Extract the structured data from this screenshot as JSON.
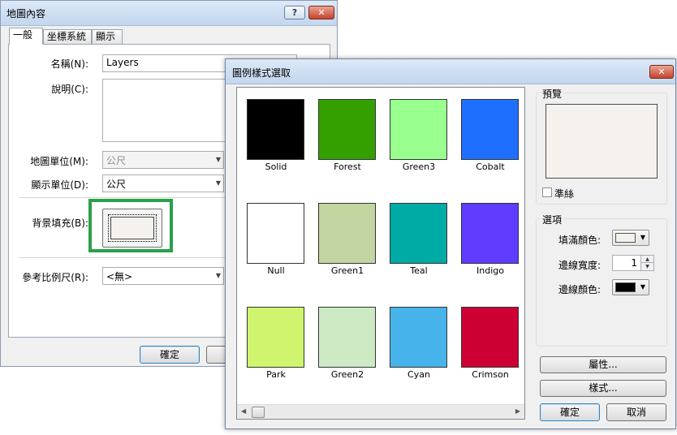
{
  "map_props": {
    "title": "地圖內容",
    "help_btn": "?",
    "close_btn": "✕",
    "tabs": [
      "一般",
      "坐標系統",
      "顯示"
    ],
    "name_label": "名稱(N):",
    "name_value": "Layers",
    "desc_label": "說明(C):",
    "desc_value": "",
    "map_unit_label": "地圖單位(M):",
    "map_unit_value": "公尺",
    "display_unit_label": "顯示單位(D):",
    "display_unit_value": "公尺",
    "bg_fill_label": "背景填充(B):",
    "ref_scale_label": "參考比例尺(R):",
    "ref_scale_value": "<無>",
    "ok_btn": "確定"
  },
  "legend_style": {
    "title": "圖例樣式選取",
    "close_btn": "✕",
    "swatches": [
      {
        "name": "Solid",
        "color": "#000000"
      },
      {
        "name": "Forest",
        "color": "#33a000"
      },
      {
        "name": "Green3",
        "color": "#99ff8f"
      },
      {
        "name": "Cobalt",
        "color": "#1f6fff"
      },
      {
        "name": "Null",
        "color": "#ffffff"
      },
      {
        "name": "Green1",
        "color": "#c3d5a0"
      },
      {
        "name": "Teal",
        "color": "#00aaa5"
      },
      {
        "name": "Indigo",
        "color": "#5f3cff"
      },
      {
        "name": "Park",
        "color": "#cff56e"
      },
      {
        "name": "Green2",
        "color": "#cdeac5"
      },
      {
        "name": "Cyan",
        "color": "#46b4ea"
      },
      {
        "name": "Crimson",
        "color": "#cc0033"
      }
    ],
    "preview_label": "預覽",
    "preview_color": "#f5f1ec",
    "grid_label": "準絲",
    "options_label": "選項",
    "fill_color_label": "填滿顏色:",
    "fill_color": "#f5f1ec",
    "border_width_label": "邊線寬度:",
    "border_width_value": "1",
    "border_color_label": "邊線顏色:",
    "border_color": "#000000",
    "properties_btn": "屬性...",
    "style_btn": "樣式...",
    "ok_btn": "確定",
    "cancel_btn": "取消"
  }
}
